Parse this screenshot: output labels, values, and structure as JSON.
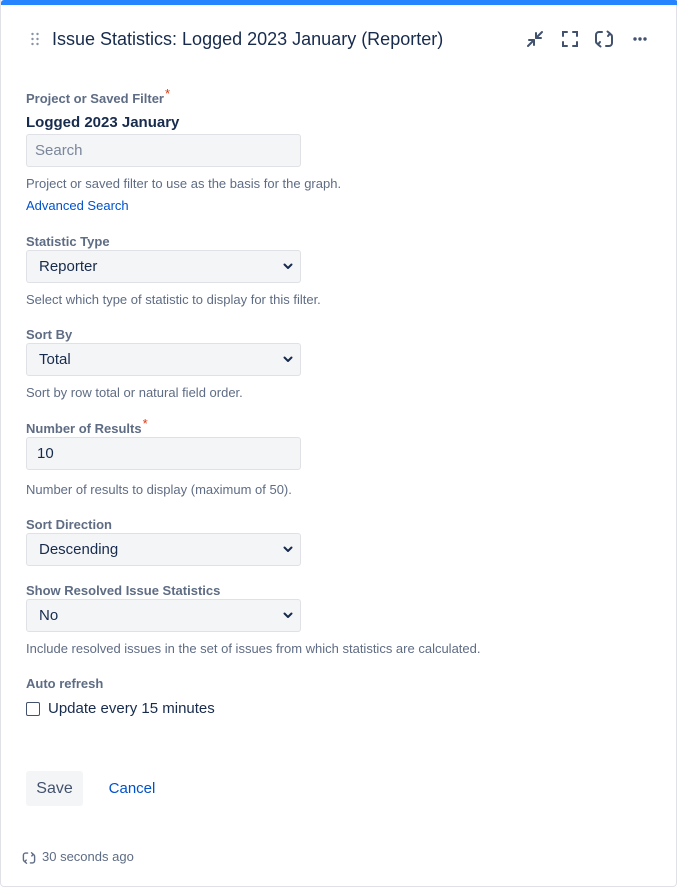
{
  "header": {
    "title": "Issue Statistics: Logged 2023 January (Reporter)",
    "accent_color": "#2684ff"
  },
  "form": {
    "filter": {
      "label": "Project or Saved Filter",
      "required_mark": "*",
      "selected_name": "Logged 2023 January",
      "search_placeholder": "Search",
      "help": "Project or saved filter to use as the basis for the graph.",
      "advanced_link": "Advanced Search"
    },
    "statistic_type": {
      "label": "Statistic Type",
      "value": "Reporter",
      "help": "Select which type of statistic to display for this filter."
    },
    "sort_by": {
      "label": "Sort By",
      "value": "Total",
      "help": "Sort by row total or natural field order."
    },
    "num_results": {
      "label": "Number of Results",
      "required_mark": "*",
      "value": "10",
      "help": "Number of results to display (maximum of 50)."
    },
    "sort_direction": {
      "label": "Sort Direction",
      "value": "Descending"
    },
    "show_resolved": {
      "label": "Show Resolved Issue Statistics",
      "value": "No",
      "help": "Include resolved issues in the set of issues from which statistics are calculated."
    },
    "auto_refresh": {
      "label": "Auto refresh",
      "checkbox_label": "Update every 15 minutes",
      "checked": false
    }
  },
  "actions": {
    "save_label": "Save",
    "cancel_label": "Cancel"
  },
  "footer": {
    "updated_text": "30 seconds ago"
  },
  "icons": {
    "drag": "drag-handle-icon",
    "minimize": "minimize-icon",
    "fullscreen": "fullscreen-icon",
    "refresh": "refresh-icon",
    "more": "more-icon",
    "chevron": "chevron-down-icon"
  }
}
